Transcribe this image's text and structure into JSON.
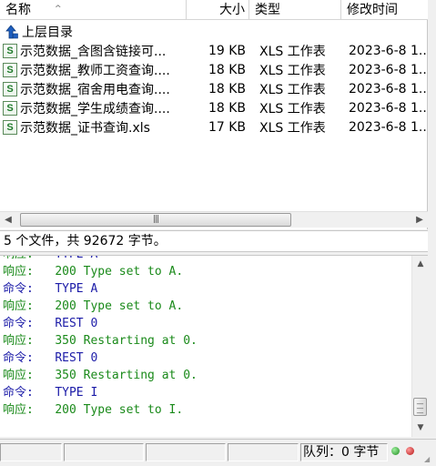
{
  "columns": {
    "name": "名称",
    "size": "大小",
    "type": "类型",
    "modified": "修改时间"
  },
  "parent_dir": "上层目录",
  "files": [
    {
      "name": "示范数据_含图含链接可...",
      "size": "19 KB",
      "type": "XLS 工作表",
      "modified": "2023-6-8 1..."
    },
    {
      "name": "示范数据_教师工资查询....",
      "size": "18 KB",
      "type": "XLS 工作表",
      "modified": "2023-6-8 1..."
    },
    {
      "name": "示范数据_宿舍用电查询....",
      "size": "18 KB",
      "type": "XLS 工作表",
      "modified": "2023-6-8 1..."
    },
    {
      "name": "示范数据_学生成绩查询....",
      "size": "18 KB",
      "type": "XLS 工作表",
      "modified": "2023-6-8 1..."
    },
    {
      "name": "示范数据_证书查询.xls",
      "size": "17 KB",
      "type": "XLS 工作表",
      "modified": "2023-6-8 1..."
    }
  ],
  "file_icon_text": "S",
  "status_summary": "5 个文件，共 92672 字节。",
  "log": [
    {
      "label": "响应:",
      "text": "TYPE A",
      "kind": "cmd"
    },
    {
      "label": "响应:",
      "text": "200 Type set to A.",
      "kind": "resp"
    },
    {
      "label": "命令:",
      "text": "TYPE A",
      "kind": "cmd"
    },
    {
      "label": "响应:",
      "text": "200 Type set to A.",
      "kind": "resp"
    },
    {
      "label": "命令:",
      "text": "REST 0",
      "kind": "cmd"
    },
    {
      "label": "响应:",
      "text": "350 Restarting at 0.",
      "kind": "resp"
    },
    {
      "label": "命令:",
      "text": "REST 0",
      "kind": "cmd"
    },
    {
      "label": "响应:",
      "text": "350 Restarting at 0.",
      "kind": "resp"
    },
    {
      "label": "命令:",
      "text": "TYPE I",
      "kind": "cmd"
    },
    {
      "label": "响应:",
      "text": "200 Type set to I.",
      "kind": "resp"
    }
  ],
  "queue_status": "队列：0 字节",
  "colors": {
    "command": "#1c1ca8",
    "response": "#1a8a1a",
    "led_online": "#1f8a1f",
    "led_busy": "#b51414"
  },
  "icons": {
    "file": "xls-file-icon",
    "parent": "parent-dir-icon",
    "sort": "sort-indicator-icon"
  }
}
